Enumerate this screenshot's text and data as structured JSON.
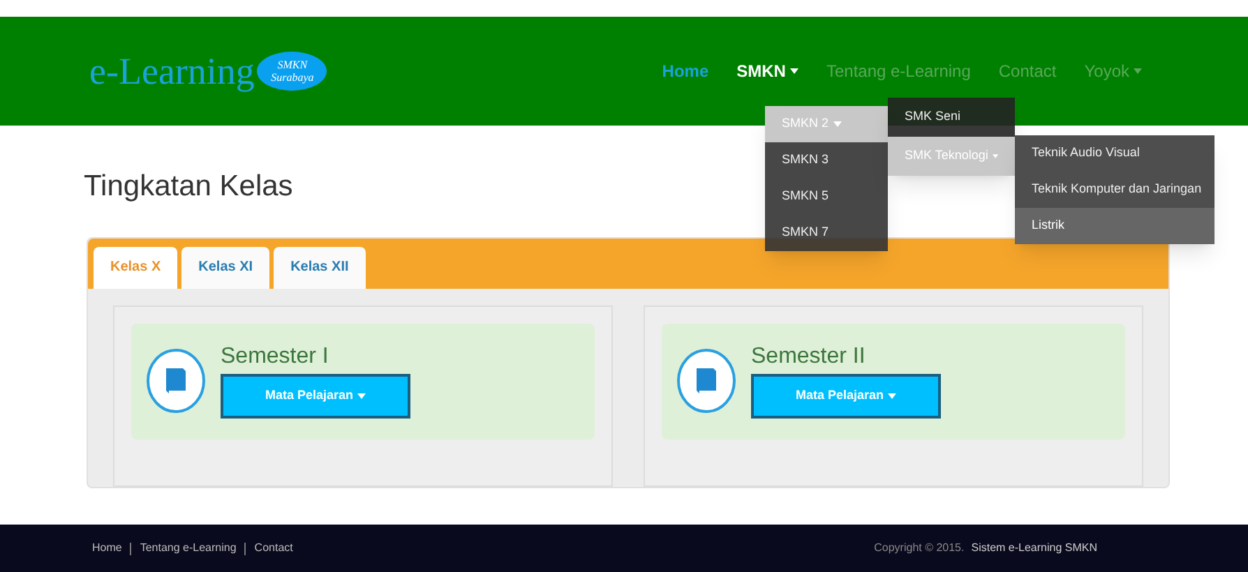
{
  "brand": {
    "name": "e-Learning",
    "badge_line_1": "SMKN",
    "badge_line_2": "Surabaya"
  },
  "nav": [
    {
      "label": "Home",
      "selected": true,
      "expanded": false,
      "dropdown": false
    },
    {
      "label": "SMKN",
      "selected": false,
      "expanded": true,
      "dropdown": true
    },
    {
      "label": "Tentang e-Learning",
      "selected": false,
      "expanded": false,
      "dropdown": false
    },
    {
      "label": "Contact",
      "selected": false,
      "expanded": false,
      "dropdown": false
    },
    {
      "label": "Yoyok",
      "selected": false,
      "expanded": false,
      "dropdown": true
    }
  ],
  "menu": [
    {
      "label": "SMKN 2",
      "selected": true,
      "dropdown": true
    },
    {
      "label": "SMKN 3",
      "selected": false,
      "dropdown": false
    },
    {
      "label": "SMKN 5",
      "selected": false,
      "dropdown": false
    },
    {
      "label": "SMKN 7",
      "selected": false,
      "dropdown": false
    }
  ],
  "submenu": [
    {
      "label": "SMK Seni",
      "selected": false,
      "dropdown": false
    },
    {
      "label": "SMK Teknologi",
      "selected": true,
      "dropdown": true
    }
  ],
  "subsubmenu": [
    {
      "label": "Teknik Audio Visual",
      "selected": false
    },
    {
      "label": "Teknik Komputer dan Jaringan",
      "selected": false
    },
    {
      "label": "Listrik",
      "selected": true
    }
  ],
  "page_title": "Tingkatan Kelas",
  "tabs": [
    {
      "label": "Kelas X",
      "selected": true
    },
    {
      "label": "Kelas XI",
      "selected": false
    },
    {
      "label": "Kelas XII",
      "selected": false
    }
  ],
  "semesters": [
    {
      "title": "Semester I",
      "button": "Mata Pelajaran"
    },
    {
      "title": "Semester II",
      "button": "Mata Pelajaran"
    }
  ],
  "footer": {
    "links": [
      "Home",
      "Tentang e-Learning",
      "Contact"
    ],
    "copyright": "Copyright © 2015.",
    "site": "Sistem e-Learning SMKN"
  }
}
